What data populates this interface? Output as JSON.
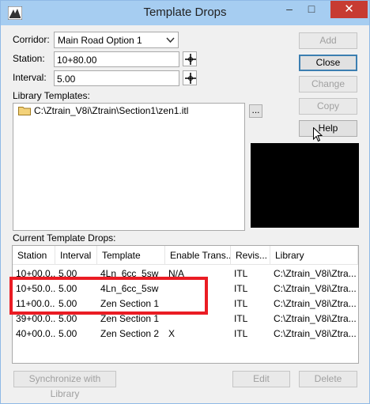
{
  "window": {
    "title": "Template Drops"
  },
  "titlebar": {
    "minimize": "–",
    "maximize": "□",
    "close": "✕"
  },
  "form": {
    "corridor_label": "Corridor:",
    "corridor_value": "Main Road Option 1",
    "station_label": "Station:",
    "station_value": "10+80.00",
    "interval_label": "Interval:",
    "interval_value": "5.00",
    "library_label": "Library Templates:",
    "library_path": "C:\\Ztrain_V8i\\Ztrain\\Section1\\zen1.itl",
    "browse_label": "..."
  },
  "buttons": {
    "add": "Add",
    "close": "Close",
    "change": "Change",
    "copy": "Copy",
    "help": "Help",
    "synchronize": "Synchronize with Library",
    "edit": "Edit",
    "delete": "Delete"
  },
  "table": {
    "label": "Current Template Drops:",
    "columns": [
      "Station",
      "Interval",
      "Template",
      "Enable Trans...",
      "Revis...",
      "Library"
    ],
    "rows": [
      [
        "10+00.0...",
        "5.00",
        "4Ln_6cc_5sw",
        "N/A",
        "ITL",
        "C:\\Ztrain_V8i\\Ztra..."
      ],
      [
        "10+50.0...",
        "5.00",
        "4Ln_6cc_5sw",
        "",
        "ITL",
        "C:\\Ztrain_V8i\\Ztra..."
      ],
      [
        "11+00.0...",
        "5.00",
        "Zen Section 1",
        "",
        "ITL",
        "C:\\Ztrain_V8i\\Ztra..."
      ],
      [
        "39+00.0...",
        "5.00",
        "Zen Section 1",
        "",
        "ITL",
        "C:\\Ztrain_V8i\\Ztra..."
      ],
      [
        "40+00.0...",
        "5.00",
        "Zen Section 2",
        "X",
        "ITL",
        "C:\\Ztrain_V8i\\Ztra..."
      ]
    ]
  },
  "colors": {
    "titlebar": "#a6cdf1",
    "close_button": "#c73b32",
    "highlight": "#ea1c24",
    "preview": "#000000"
  },
  "icons": {
    "app": "app-icon",
    "target": "crosshair-icon",
    "folder": "folder-icon",
    "dropdown": "chevron-down-icon",
    "cursor": "mouse-pointer-icon"
  }
}
